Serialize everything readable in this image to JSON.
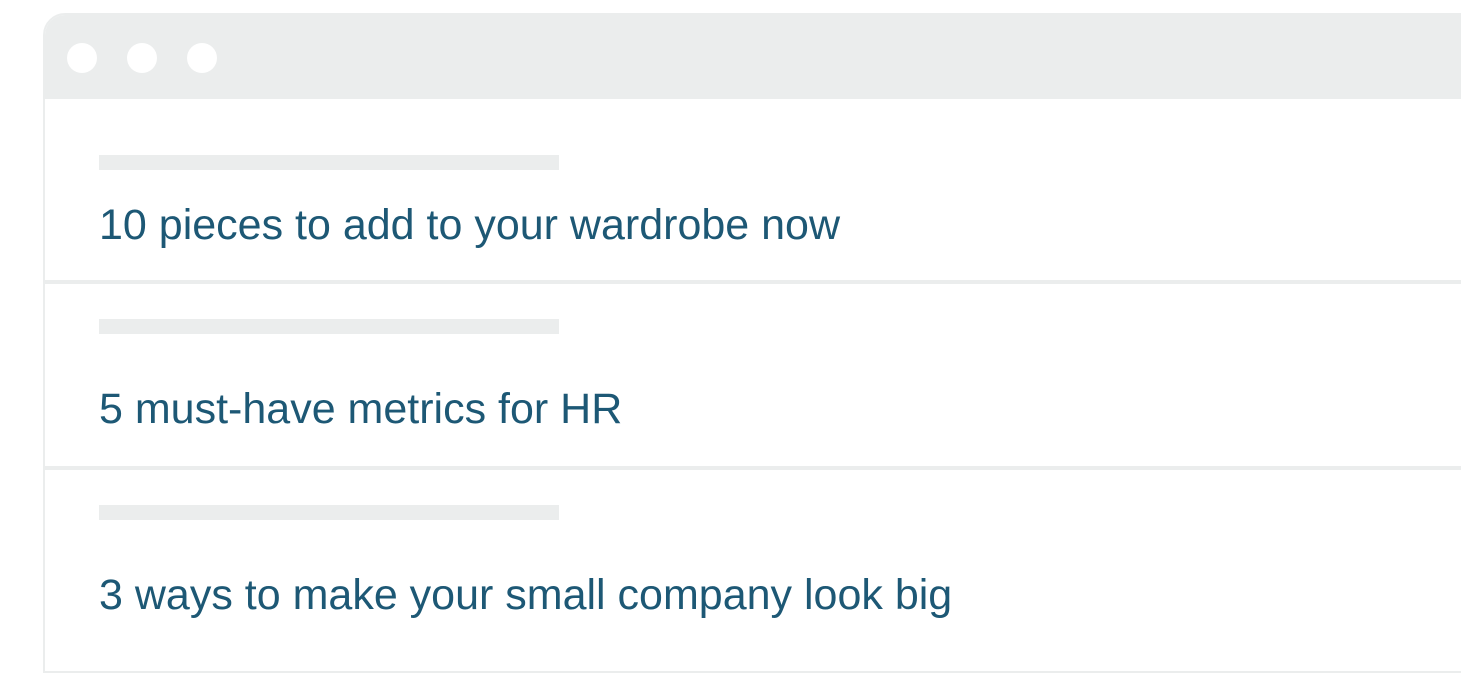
{
  "window": {
    "controls": [
      "window-dot-icon",
      "window-dot-icon",
      "window-dot-icon"
    ]
  },
  "articles": [
    {
      "title": "10 pieces to add to your wardrobe now"
    },
    {
      "title": "5 must-have metrics for HR"
    },
    {
      "title": "3 ways to make your small company look big"
    }
  ],
  "colors": {
    "headline": "#1d5875",
    "chrome": "#ebeded",
    "background": "#ffffff"
  }
}
